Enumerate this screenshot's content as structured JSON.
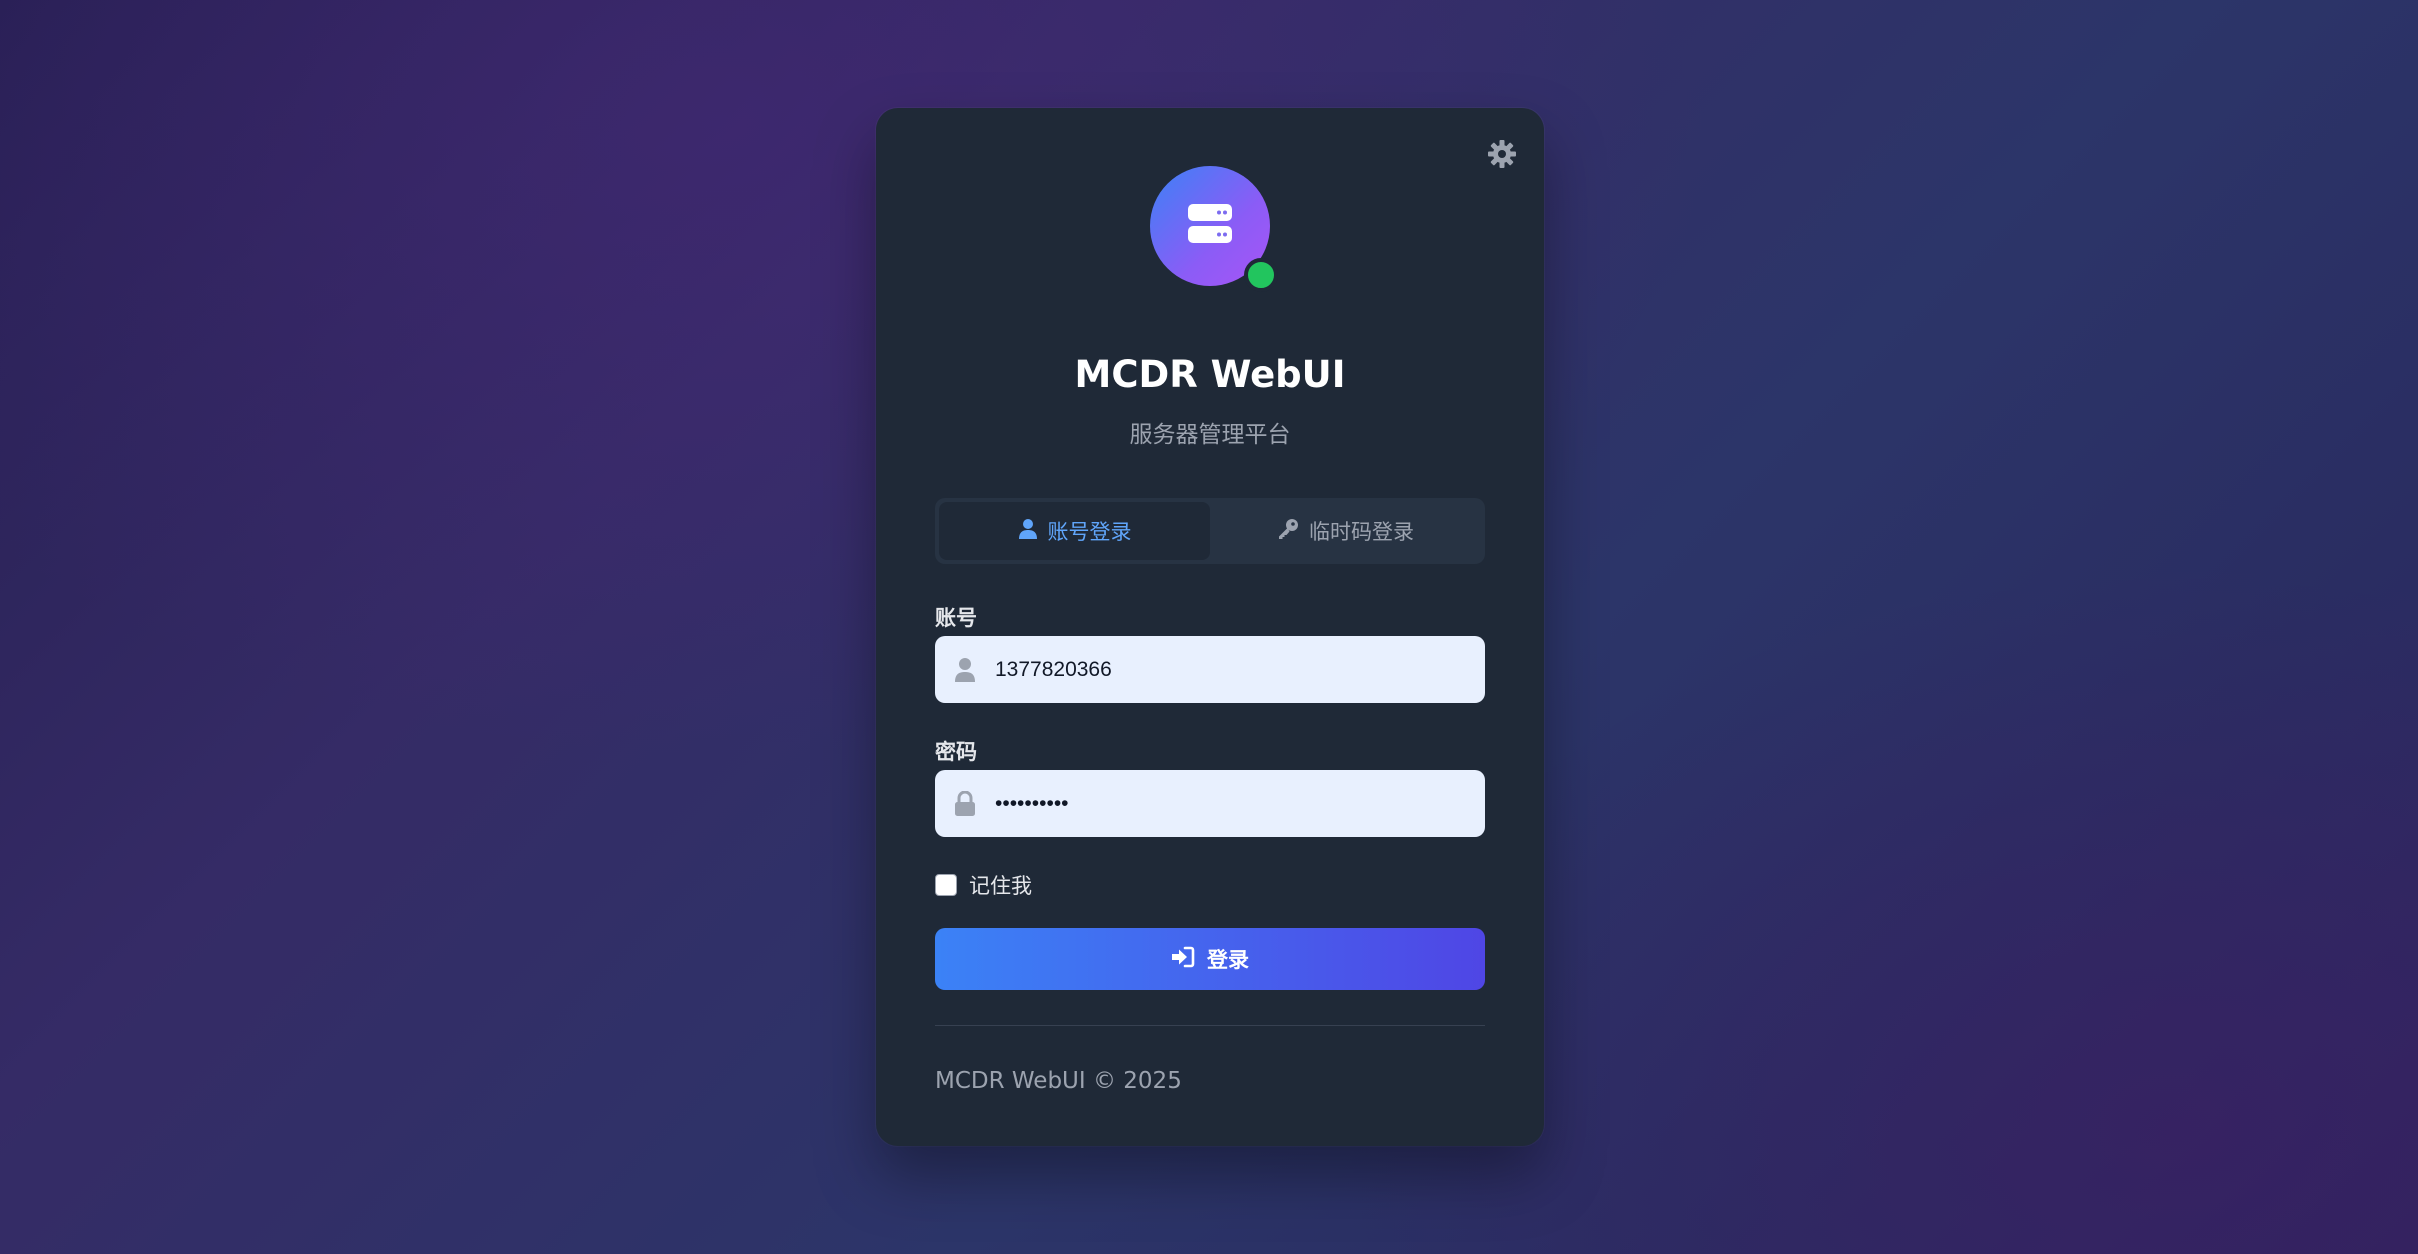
{
  "theme_toggle": {
    "icon": "gear-icon"
  },
  "brand": {
    "logo_icon": "server-icon",
    "status_color": "#22c55e",
    "title": "MCDR WebUI",
    "subtitle": "服务器管理平台"
  },
  "tabs": [
    {
      "label": "账号登录",
      "icon": "user-icon",
      "active": true
    },
    {
      "label": "临时码登录",
      "icon": "key-icon",
      "active": false
    }
  ],
  "form": {
    "account_label": "账号",
    "account_value": "1377820366",
    "password_label": "密码",
    "password_value": "1234567890",
    "remember_label": "记住我",
    "remember_checked": false,
    "submit_label": "登录"
  },
  "footer": {
    "text": "MCDR WebUI © 2025"
  },
  "colors": {
    "accent": "#60a5fa",
    "button_start": "#3b82f6",
    "button_end": "#4f46e5",
    "card_bg": "#1f2937"
  }
}
